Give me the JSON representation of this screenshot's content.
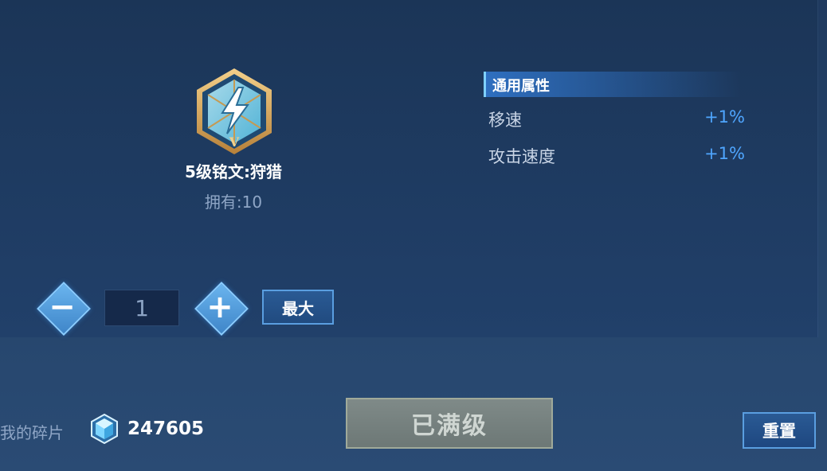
{
  "rune": {
    "icon": "lightning-rune-icon",
    "level_roman": "V",
    "title": "5级铭文:狩猎",
    "owned": "拥有:10"
  },
  "attributes": {
    "header": "通用属性",
    "rows": [
      {
        "name": "移速",
        "value": "+1%"
      },
      {
        "name": "攻击速度",
        "value": "+1%"
      }
    ]
  },
  "quantity": {
    "minus_icon": "minus-icon",
    "value": "1",
    "plus_icon": "plus-icon",
    "max_label": "最大"
  },
  "footer": {
    "fragments_label": "我的碎片",
    "fragments_icon": "crystal-gem-icon",
    "fragments_count": "247605",
    "maxed_label": "已满级",
    "reset_label": "重置"
  },
  "colors": {
    "accent_blue": "#4fa6ff",
    "button_border": "#5a9ee0",
    "disabled_button": "#7f8a88"
  }
}
